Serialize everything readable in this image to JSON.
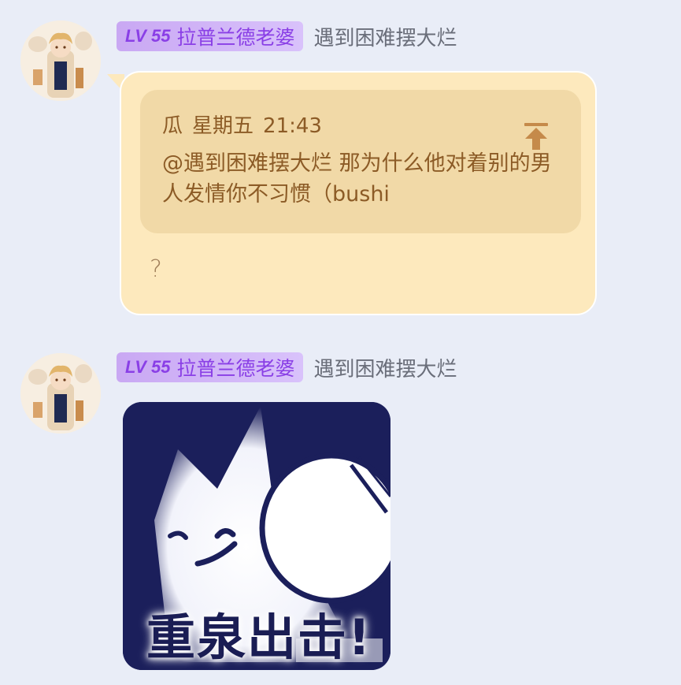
{
  "messages": [
    {
      "sender": {
        "level": "LV 55",
        "title": "拉普兰德老婆",
        "nickname": "遇到困难摆大烂",
        "avatar_icon": "anime-character-avatar"
      },
      "quote": {
        "author": "瓜",
        "day": "星期五",
        "time": "21:43",
        "text": "@遇到困难摆大烂 那为什么他对着别的男人发情你不习惯（bushi",
        "jump_icon": "jump-to-top-icon"
      },
      "text": "?"
    },
    {
      "sender": {
        "level": "LV 55",
        "title": "拉普兰德老婆",
        "nickname": "遇到困难摆大烂",
        "avatar_icon": "anime-character-avatar"
      },
      "sticker": {
        "caption": "重泉出击!",
        "icon": "cat-table-tennis-sticker"
      }
    }
  ],
  "colors": {
    "background": "#e9edf7",
    "bubble": "#fde9bd",
    "quote_bg": "#f1d9a7",
    "quote_text": "#8c5b26",
    "badge_bg": "#c9a8f3",
    "badge_text": "#8a3fe6",
    "nickname": "#6a6e7a"
  }
}
